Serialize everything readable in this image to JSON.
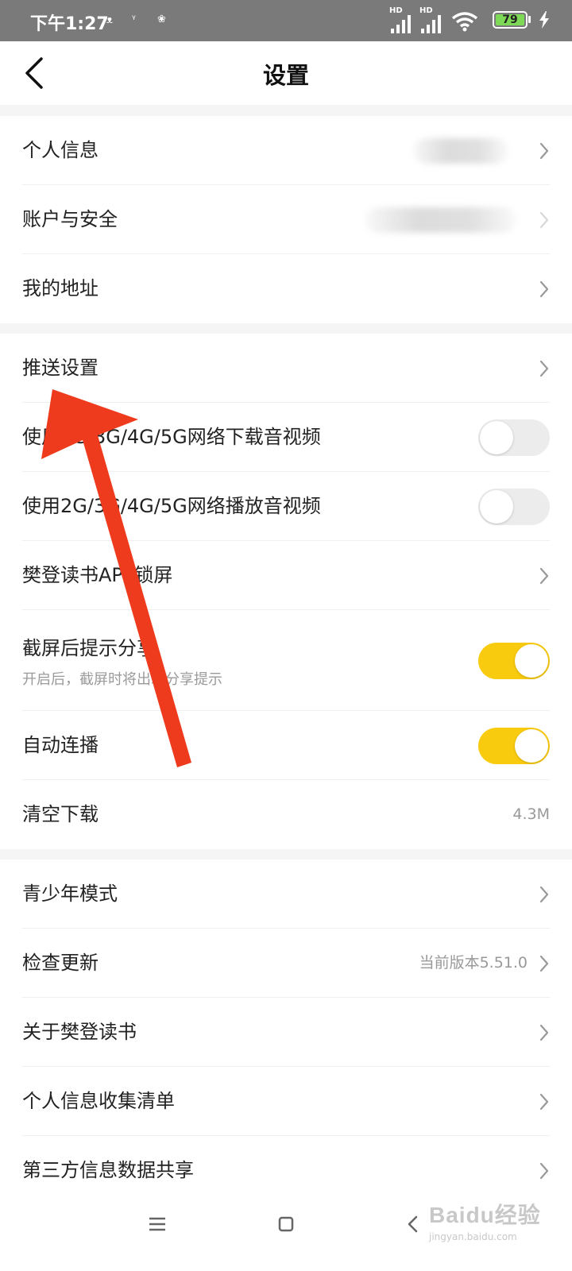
{
  "status_bar": {
    "time": "下午1:27",
    "network_1": "HD",
    "network_2": "HD",
    "battery": "79",
    "icons": [
      "notification-icon",
      "notification-icon",
      "notification-icon",
      "signal-icon",
      "signal-icon",
      "wifi-icon",
      "battery-icon",
      "charging-icon"
    ]
  },
  "header": {
    "title": "设置",
    "back_icon": "chevron-left-icon"
  },
  "sections": {
    "account": [
      {
        "label": "个人信息",
        "value": "",
        "blurred": true
      },
      {
        "label": "账户与安全",
        "value": "",
        "blurred": true
      },
      {
        "label": "我的地址"
      }
    ],
    "preferences": [
      {
        "label": "推送设置"
      },
      {
        "label": "使用2G/3G/4G/5G网络下载音视频",
        "toggle": false
      },
      {
        "label": "使用2G/3G/4G/5G网络播放音视频",
        "toggle": false
      },
      {
        "label": "樊登读书APP锁屏"
      },
      {
        "label": "截屏后提示分享",
        "sub": "开启后，截屏时将出现分享提示",
        "toggle": true
      },
      {
        "label": "自动连播",
        "toggle": true
      },
      {
        "label": "清空下载",
        "value": "4.3M"
      }
    ],
    "about": [
      {
        "label": "青少年模式"
      },
      {
        "label": "检查更新",
        "value": "当前版本5.51.0"
      },
      {
        "label": "关于樊登读书"
      },
      {
        "label": "个人信息收集清单"
      },
      {
        "label": "第三方信息数据共享"
      }
    ]
  },
  "nav_bar": {
    "icons": [
      "menu-icon",
      "home-icon",
      "back-icon"
    ]
  },
  "watermark": {
    "brand": "Baidu经验",
    "site": "jingyan.baidu.com"
  },
  "colors": {
    "toggle_on": "#f9cb0f",
    "toggle_off": "#ececec",
    "annotation_arrow": "#ee3b1d",
    "status_bar": "#7a7a7a",
    "battery_fill": "#7ed957"
  }
}
